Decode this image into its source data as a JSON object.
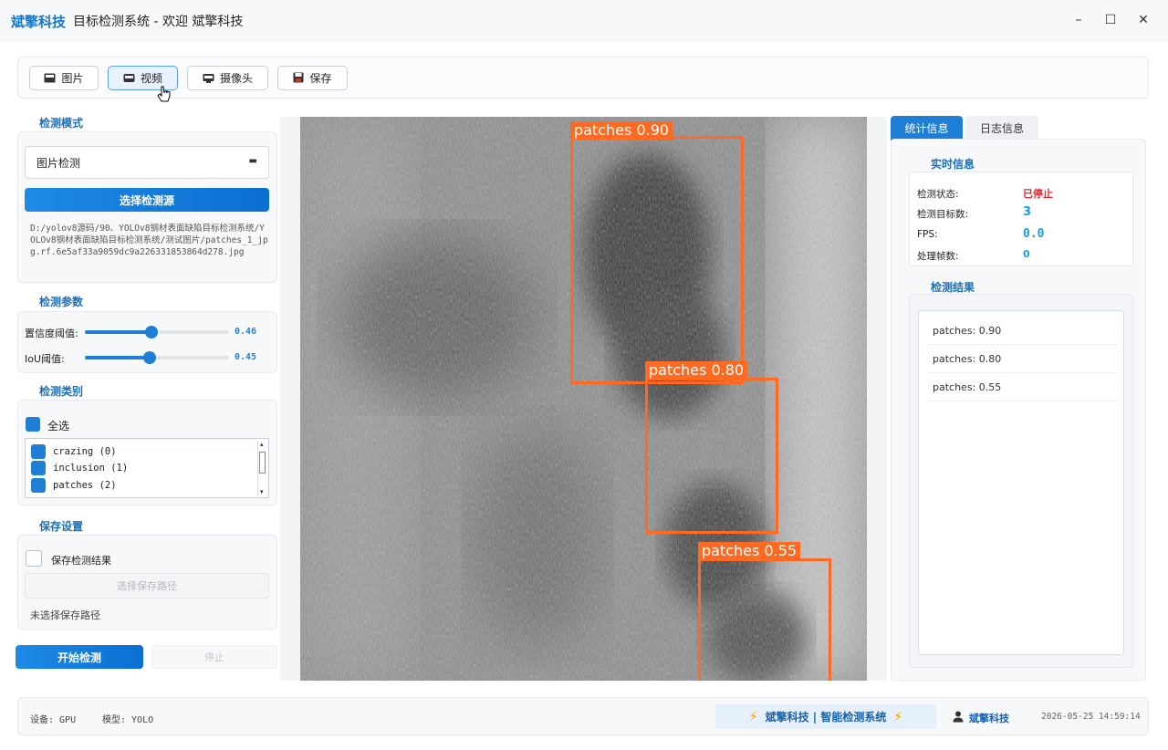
{
  "window": {
    "brand": "斌擎科技",
    "title": "目标检测系统 - 欢迎 斌擎科技",
    "controls": {
      "minimize": "–",
      "maximize": "☐",
      "close": "✕"
    }
  },
  "toolbar": {
    "image_label": "图片",
    "video_label": "视频",
    "camera_label": "摄像头",
    "save_label": "保存"
  },
  "detect_mode": {
    "title": "检测模式",
    "selected": "图片检测",
    "select_source_label": "选择检测源",
    "path": "D:/yolov8源码/90、YOLOv8钢材表面缺陷目标检测系统/YOLOv8钢材表面缺陷目标检测系统/测试图片/patches_1_jpg.rf.6e5af33a9059dc9a226331853864d278.jpg"
  },
  "params": {
    "title": "检测参数",
    "conf_label": "置信度阈值:",
    "conf_value": "0.46",
    "conf_fraction": 0.46,
    "iou_label": "IoU阈值:",
    "iou_value": "0.45",
    "iou_fraction": 0.45
  },
  "classes": {
    "title": "检测类别",
    "select_all": "全选",
    "items": [
      "crazing (0)",
      "inclusion (1)",
      "patches (2)"
    ]
  },
  "save": {
    "title": "保存设置",
    "save_results": "保存检测结果",
    "choose_path": "选择保存路径",
    "path_status": "未选择保存路径"
  },
  "actions": {
    "start": "开始检测",
    "stop": "停止"
  },
  "detections": [
    {
      "label": "patches 0.90"
    },
    {
      "label": "patches 0.80"
    },
    {
      "label": "patches 0.55"
    }
  ],
  "right": {
    "tab_stats": "统计信息",
    "tab_log": "日志信息",
    "realtime_title": "实时信息",
    "status_label": "检测状态:",
    "status_value": "已停止",
    "count_label": "检测目标数:",
    "count_value": "3",
    "fps_label": "FPS:",
    "fps_value": "0.0",
    "frames_label": "处理帧数:",
    "frames_value": "0",
    "results_title": "检测结果",
    "results": [
      "patches: 0.90",
      "patches: 0.80",
      "patches: 0.55"
    ]
  },
  "statusbar": {
    "device": "设备: GPU",
    "model": "模型: YOLO",
    "brand_text": "斌擎科技 | 智能检测系统",
    "user": "斌擎科技",
    "datetime": "2026-05-25 14:59:14"
  },
  "colors": {
    "accent": "#1f7fd6",
    "box": "#ff6a23",
    "stopped": "#e0282e",
    "value": "#1f9be6"
  },
  "icons": {
    "image": "image-icon",
    "video": "video-icon",
    "camera": "camera-icon",
    "save": "floppy-icon",
    "user": "user-icon",
    "bolt": "lightning-icon"
  }
}
